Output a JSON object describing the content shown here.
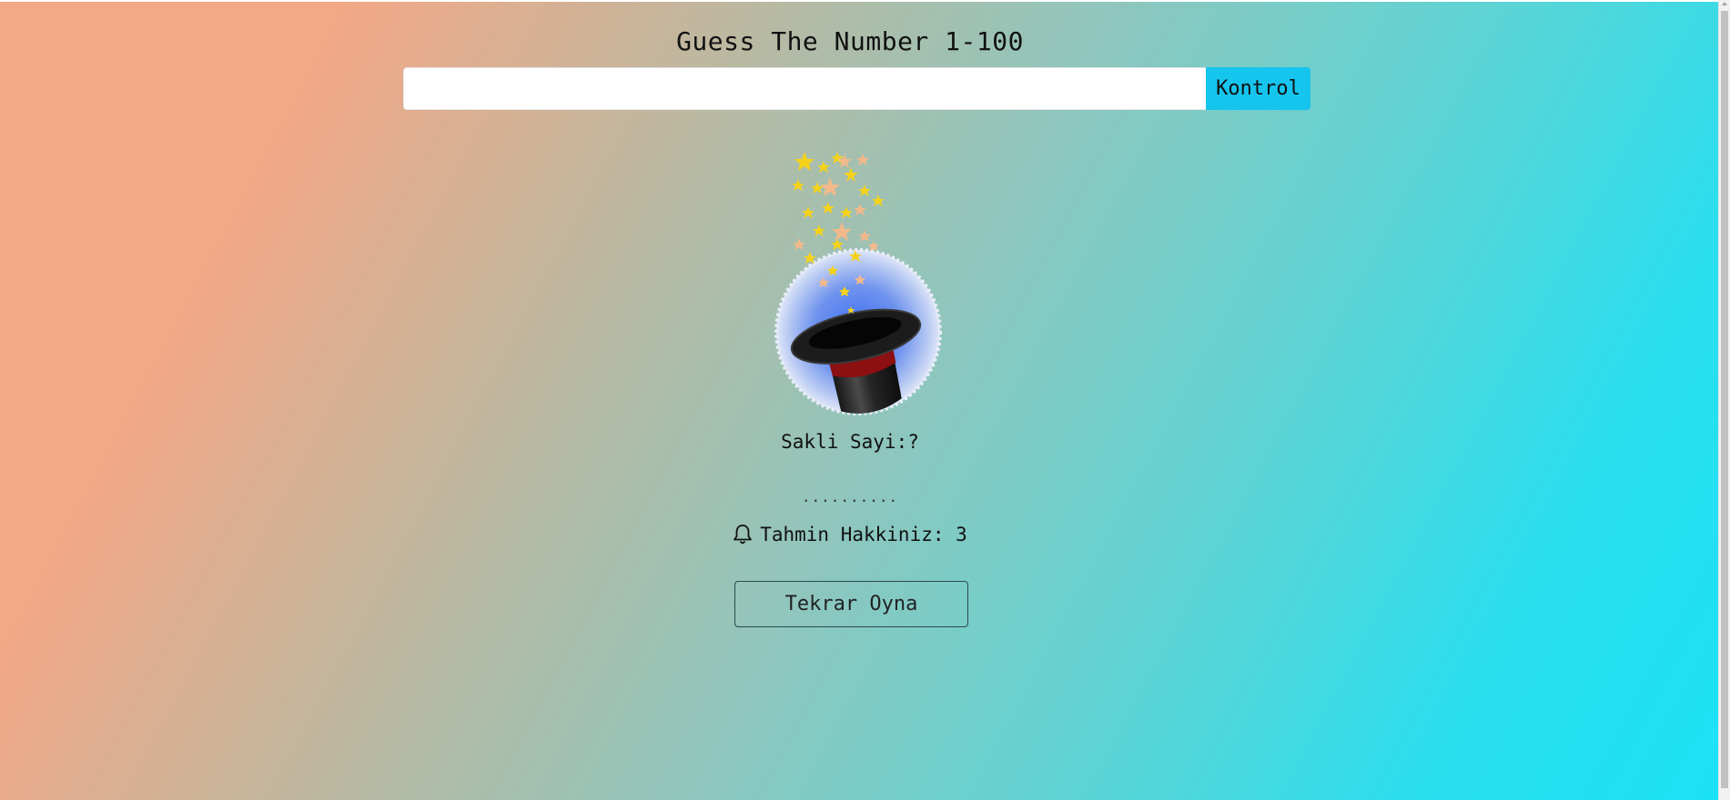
{
  "header": {
    "title": "Guess The Number 1-100"
  },
  "guess_form": {
    "input_value": "",
    "input_placeholder": "",
    "check_label": "Kontrol"
  },
  "illustration": {
    "icon": "magic-hat-icon"
  },
  "hidden_number": {
    "label": "Sakli Sayi:?"
  },
  "feedback": {
    "text": ".........."
  },
  "attempts": {
    "icon": "bell-icon",
    "label": "Tahmin Hakkiniz: 3"
  },
  "replay": {
    "label": "Tekrar Oyna"
  },
  "colors": {
    "accent": "#15c5ee",
    "gradient_start": "#f3a886",
    "gradient_end": "#1ce2f6"
  }
}
